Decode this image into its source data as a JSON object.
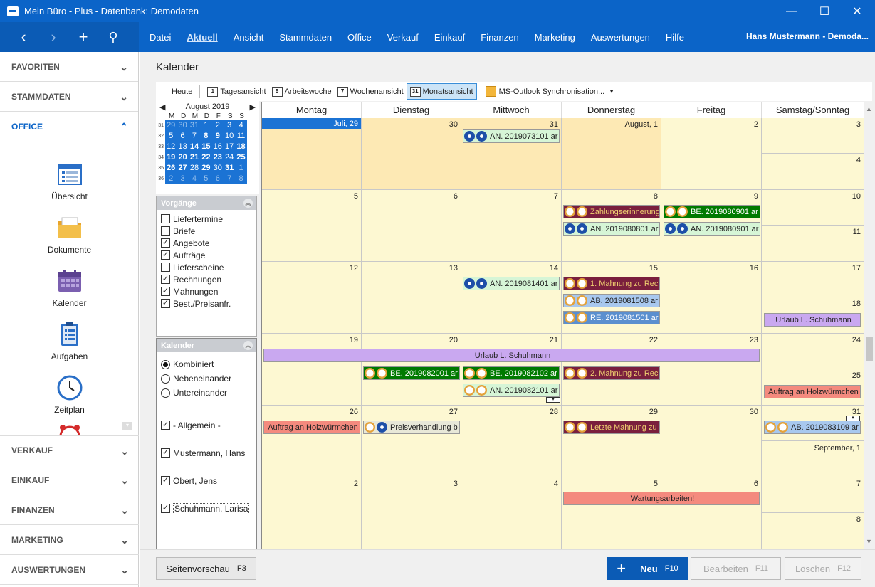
{
  "window": {
    "title": "Mein Büro - Plus - Datenbank: Demodaten",
    "minimize": "—",
    "maximize": "☐",
    "close": "✕"
  },
  "nav": {
    "back": "‹",
    "forward": "›",
    "add": "+",
    "search": "⚲"
  },
  "menu": [
    "Datei",
    "Aktuell",
    "Ansicht",
    "Stammdaten",
    "Office",
    "Verkauf",
    "Einkauf",
    "Finanzen",
    "Marketing",
    "Auswertungen",
    "Hilfe"
  ],
  "menu_active": "Aktuell",
  "user": "Hans Mustermann - Demoda...",
  "sidebar": {
    "favoriten": "FAVORITEN",
    "stammdaten": "STAMMDATEN",
    "office": "OFFICE",
    "items": [
      "Übersicht",
      "Dokumente",
      "Kalender",
      "Aufgaben",
      "Zeitplan"
    ],
    "verkauf": "VERKAUF",
    "einkauf": "EINKAUF",
    "finanzen": "FINANZEN",
    "marketing": "MARKETING",
    "auswertungen": "AUSWERTUNGEN"
  },
  "page": {
    "title": "Kalender"
  },
  "toolbar": {
    "heute": "Heute",
    "tag": "Tagesansicht",
    "arbeitswoche": "Arbeitswoche",
    "woche": "Wochenansicht",
    "monat": "Monatsansicht",
    "outlook": "MS-Outlook Synchronisation...",
    "tag_icon": "1",
    "aw_icon": "5",
    "w_icon": "7",
    "m_icon": "31"
  },
  "minical": {
    "month": "August 2019",
    "days": [
      "M",
      "D",
      "M",
      "D",
      "F",
      "S",
      "S"
    ],
    "weeks": [
      {
        "wk": "31",
        "days": [
          "29",
          "30",
          "31",
          "1",
          "2",
          "3",
          "4"
        ]
      },
      {
        "wk": "32",
        "days": [
          "5",
          "6",
          "7",
          "8",
          "9",
          "10",
          "11"
        ]
      },
      {
        "wk": "33",
        "days": [
          "12",
          "13",
          "14",
          "15",
          "16",
          "17",
          "18"
        ]
      },
      {
        "wk": "34",
        "days": [
          "19",
          "20",
          "21",
          "22",
          "23",
          "24",
          "25"
        ]
      },
      {
        "wk": "35",
        "days": [
          "26",
          "27",
          "28",
          "29",
          "30",
          "31",
          "1"
        ]
      },
      {
        "wk": "36",
        "days": [
          "2",
          "3",
          "4",
          "5",
          "6",
          "7",
          "8"
        ]
      }
    ]
  },
  "vorgaenge": {
    "title": "Vorgänge",
    "items": [
      {
        "label": "Liefertermine",
        "checked": false
      },
      {
        "label": "Briefe",
        "checked": false
      },
      {
        "label": "Angebote",
        "checked": true
      },
      {
        "label": "Aufträge",
        "checked": true
      },
      {
        "label": "Lieferscheine",
        "checked": false
      },
      {
        "label": "Rechnungen",
        "checked": true
      },
      {
        "label": "Mahnungen",
        "checked": true
      },
      {
        "label": "Best./Preisanfr.",
        "checked": true
      }
    ]
  },
  "kalender": {
    "title": "Kalender",
    "modes": [
      "Kombiniert",
      "Nebeneinander",
      "Untereinander"
    ],
    "calendars": [
      "- Allgemein -",
      "Mustermann, Hans",
      "Obert, Jens",
      "Schuhmann, Larisa"
    ]
  },
  "grid": {
    "headers": [
      "Montag",
      "Dienstag",
      "Mittwoch",
      "Donnerstag",
      "Freitag",
      "Samstag/Sonntag"
    ],
    "weeks": [
      [
        "Juli, 29",
        "30",
        "31",
        "August, 1",
        "2",
        "3",
        "4"
      ],
      [
        "5",
        "6",
        "7",
        "8",
        "9",
        "10",
        "11"
      ],
      [
        "12",
        "13",
        "14",
        "15",
        "16",
        "17",
        "18"
      ],
      [
        "19",
        "20",
        "21",
        "22",
        "23",
        "24",
        "25"
      ],
      [
        "26",
        "27",
        "28",
        "29",
        "30",
        "31",
        "September, 1"
      ],
      [
        "2",
        "3",
        "4",
        "5",
        "6",
        "7",
        "8"
      ]
    ],
    "events": {
      "e1": "AN. 2019073101 ar",
      "e2": "Zahlungserinnerung",
      "e3": "AN. 2019080801 ar",
      "e4": "BE. 2019080901 ar",
      "e5": "AN. 2019080901 ar",
      "e6": "AN. 2019081401 ar",
      "e7": "1. Mahnung zu Rec",
      "e8": "AB. 2019081508 ar",
      "e9": "RE. 2019081501 ar",
      "e10": "Urlaub L. Schuhmann",
      "e11": "Urlaub L. Schuhmann",
      "e12": "BE. 2019082001 ar",
      "e13": "BE. 2019082102 ar",
      "e14": "2. Mahnung zu Rec",
      "e15": "AN. 2019082101 ar",
      "e16": "Auftrag an Holzwürmchen",
      "e17": "Auftrag an Holzwürmchen",
      "e18": "Preisverhandlung b",
      "e19": "Letzte  Mahnung zu",
      "e20": "AB. 2019083109 ar",
      "e21": "Wartungsarbeiten!"
    }
  },
  "bottom": {
    "preview": "Seitenvorschau",
    "preview_key": "F3",
    "neu": "Neu",
    "neu_key": "F10",
    "bearbeiten": "Bearbeiten",
    "bearbeiten_key": "F11",
    "loeschen": "Löschen",
    "loeschen_key": "F12"
  },
  "colors": {
    "accent": "#0b64c8",
    "calendar_bg": "#fdf8d2",
    "weekend_bg": "#fde9b4",
    "green_event": "#007a00",
    "maroon_event": "#7a1f3d",
    "light_green": "#d6f5d6",
    "light_blue": "#a8c8ee",
    "purple": "#c9a8f0",
    "salmon": "#f48a7e"
  }
}
